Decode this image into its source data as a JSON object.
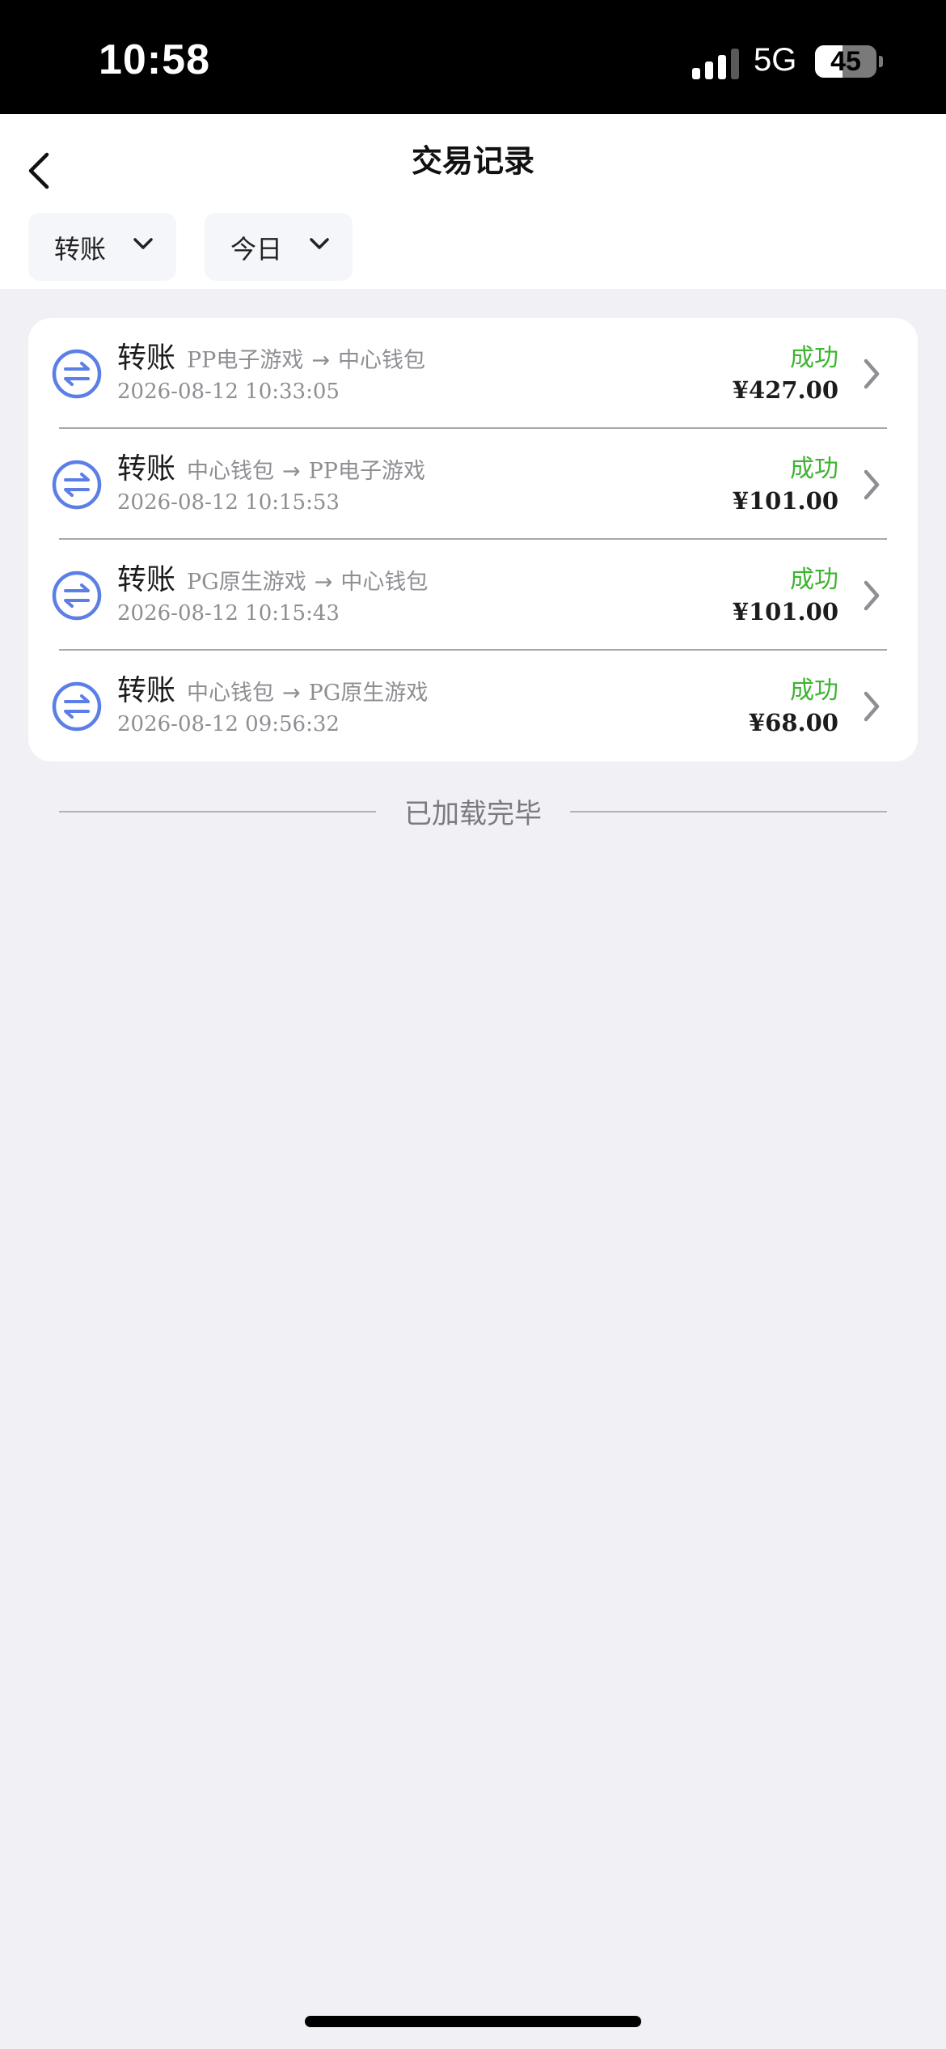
{
  "status_bar": {
    "time": "10:58",
    "network": "5G",
    "battery": "45",
    "battery_level": 0.45
  },
  "header": {
    "title": "交易记录",
    "back_icon": "chevron-left-icon"
  },
  "filters": [
    {
      "label": "转账",
      "icon": "chevron-down-icon"
    },
    {
      "label": "今日",
      "icon": "chevron-down-icon"
    }
  ],
  "transactions": [
    {
      "type": "转账",
      "from": "PP电子游戏",
      "arrow": "→",
      "to": "中心钱包",
      "time": "2026-08-12 10:33:05",
      "status": "成功",
      "amount": "¥427.00"
    },
    {
      "type": "转账",
      "from": "中心钱包",
      "arrow": "→",
      "to": "PP电子游戏",
      "time": "2026-08-12 10:15:53",
      "status": "成功",
      "amount": "¥101.00"
    },
    {
      "type": "转账",
      "from": "PG原生游戏",
      "arrow": "→",
      "to": "中心钱包",
      "time": "2026-08-12 10:15:43",
      "status": "成功",
      "amount": "¥101.00"
    },
    {
      "type": "转账",
      "from": "中心钱包",
      "arrow": "→",
      "to": "PG原生游戏",
      "time": "2026-08-12 09:56:32",
      "status": "成功",
      "amount": "¥68.00"
    }
  ],
  "list_end_text": "已加载完毕",
  "colors": {
    "accent": "#5b7fe6",
    "success": "#3db42f",
    "background": "#f0f0f5"
  }
}
